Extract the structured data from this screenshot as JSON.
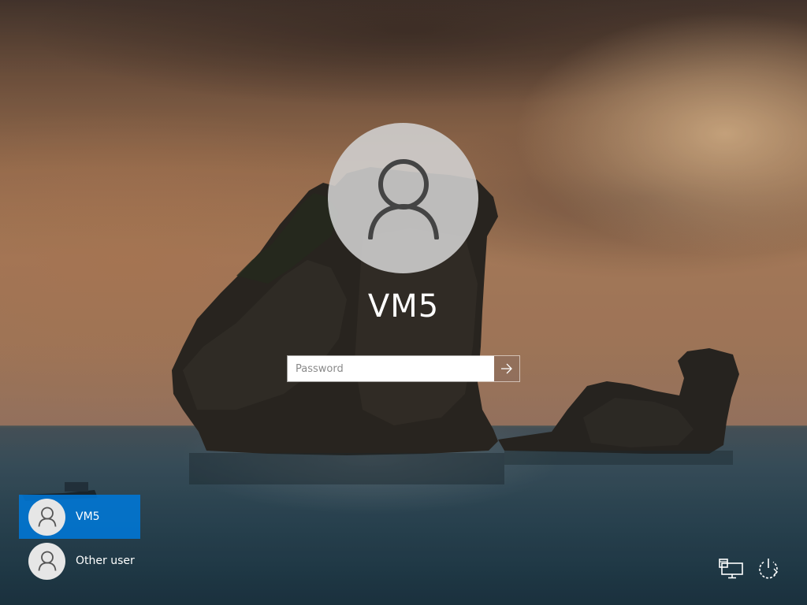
{
  "login": {
    "user_name": "VM5",
    "password_placeholder": "Password"
  },
  "user_list": [
    {
      "name": "VM5",
      "selected": true
    },
    {
      "name": "Other user",
      "selected": false
    }
  ],
  "icons": {
    "avatar": "user-silhouette-icon",
    "submit": "arrow-right-icon",
    "network": "network-icon",
    "power": "power-icon"
  },
  "colors": {
    "selection": "#0078d7",
    "text": "#ffffff"
  }
}
